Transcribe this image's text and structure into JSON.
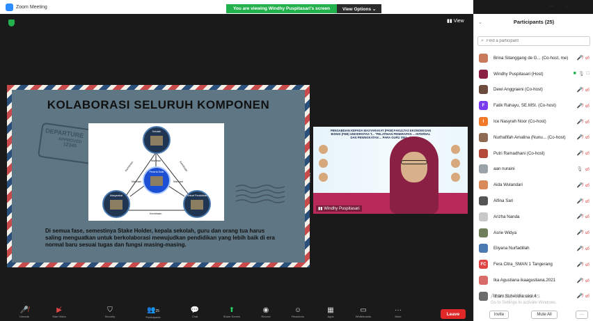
{
  "window": {
    "title": "Zoom Meeting",
    "share_banner": "You are viewing Windhy Puspitasari's screen",
    "view_options": "View Options ⌄",
    "minimize": "–",
    "maximize": "▫",
    "view_label": "View"
  },
  "slide": {
    "title": "KOLABORASI SELURUH KOMPONEN",
    "stamp_line1": "DEPARTURE",
    "stamp_line2": "APPROVED",
    "stamp_line3": "12345",
    "node_top": "Sekolah",
    "node_center": "Peserta Didik",
    "node_left": "Masyarakat",
    "node_right": "Sekuel Pendidikan",
    "edge_top_inner": "Manfaat",
    "edge_left_inner": "Manfaat",
    "edge_right_inner": "Manfaat",
    "edge_left_outer": "Kemitraan",
    "edge_right_outer": "Kemitraan",
    "edge_bottom": "Kemitraan",
    "body_text": "Di semua fase, semestinya Stake Holder, kepala sekolah, guru dan orang tua harus saling menguatkan untuk berkolaborasi mewujudkan pendidikan yang lebih baik di era normal baru sesuai tugas dan fungsi masing-masing."
  },
  "video": {
    "banner_text": "PENGABDIAN KEPADA MASYARAKAT (PKM) FAKULTAS EKONOMI DAN BISNIS (FEB) UNIVERSITAS T... \"PELATIHAN PENERAPAN ... INTERNAL DAN PENINGKATAN ... PARA GURU SMA...\"",
    "participant_name": "Windhy Puspitasari"
  },
  "toolbar": {
    "items": [
      {
        "icon": "mic-muted-icon",
        "glyph": "🎤̸",
        "label": "Unmute",
        "color": "red"
      },
      {
        "icon": "video-off-icon",
        "glyph": "▶̸",
        "label": "Start Video",
        "color": "red"
      },
      {
        "icon": "security-icon",
        "glyph": "⛉",
        "label": "Security",
        "color": ""
      },
      {
        "icon": "participants-icon",
        "glyph": "👥",
        "label": "Participants",
        "count": "25",
        "color": ""
      },
      {
        "icon": "chat-icon",
        "glyph": "💬",
        "label": "Chat",
        "color": ""
      },
      {
        "icon": "share-screen-icon",
        "glyph": "⬆",
        "label": "Share Screen",
        "color": "green"
      },
      {
        "icon": "record-icon",
        "glyph": "◉",
        "label": "Record",
        "color": ""
      },
      {
        "icon": "reactions-icon",
        "glyph": "☺",
        "label": "Reactions",
        "color": ""
      },
      {
        "icon": "apps-icon",
        "glyph": "▦",
        "label": "Apps",
        "color": ""
      },
      {
        "icon": "whiteboard-icon",
        "glyph": "▭",
        "label": "Whiteboards",
        "color": ""
      },
      {
        "icon": "more-icon",
        "glyph": "···",
        "label": "More",
        "color": ""
      }
    ],
    "leave_label": "Leave"
  },
  "panel": {
    "title": "Participants (25)",
    "search_placeholder": "Find a participant",
    "participants": [
      {
        "name": "Brina Sitanggang de G...  (Co-host, me)",
        "avatar": "photo",
        "avatar_color": "#c97a5b",
        "initials": "",
        "mic": "muted",
        "cam": "off"
      },
      {
        "name": "Windhy Puspitasari (Host)",
        "avatar": "photo",
        "avatar_color": "#8a2044",
        "initials": "",
        "mic": "on",
        "cam": "on"
      },
      {
        "name": "Dewi Anggraeni (Co-host)",
        "avatar": "photo",
        "avatar_color": "#6b4b3e",
        "initials": "",
        "mic": "muted",
        "cam": "off"
      },
      {
        "name": "Fatik Rahayu, SE.MSI. (Co-host)",
        "avatar": "initial",
        "avatar_color": "#7a3cf0",
        "initials": "F",
        "mic": "muted",
        "cam": "off"
      },
      {
        "name": "Ice Nasyrah Noor (Co-host)",
        "avatar": "initial",
        "avatar_color": "#f07a2a",
        "initials": "I",
        "mic": "muted",
        "cam": "off"
      },
      {
        "name": "Nurhafifah Amalina (Nunu...  (Co-host)",
        "avatar": "photo",
        "avatar_color": "#8e6a52",
        "initials": "",
        "mic": "muted",
        "cam": "off"
      },
      {
        "name": "Putri Ramadhani (Co-host)",
        "avatar": "photo",
        "avatar_color": "#b34a3a",
        "initials": "",
        "mic": "muted",
        "cam": "off"
      },
      {
        "name": "aan nuraini",
        "avatar": "photo",
        "avatar_color": "#9aa3a8",
        "initials": "",
        "mic": "on",
        "cam": "off"
      },
      {
        "name": "Aida Wulandari",
        "avatar": "photo",
        "avatar_color": "#d98a5a",
        "initials": "",
        "mic": "muted",
        "cam": "off"
      },
      {
        "name": "Alfina Sari",
        "avatar": "photo",
        "avatar_color": "#555555",
        "initials": "",
        "mic": "muted",
        "cam": "off"
      },
      {
        "name": "Arizha Nanda",
        "avatar": "photo",
        "avatar_color": "#c8c8c8",
        "initials": "",
        "mic": "muted",
        "cam": "off"
      },
      {
        "name": "Asrie Widya",
        "avatar": "photo",
        "avatar_color": "#6f7f5a",
        "initials": "",
        "mic": "muted",
        "cam": "off"
      },
      {
        "name": "Eliyana Nurfadillah",
        "avatar": "photo",
        "avatar_color": "#4a7ab0",
        "initials": "",
        "mic": "muted",
        "cam": "off"
      },
      {
        "name": "Fera Citra_SMAN 1 Tangerang",
        "avatar": "initial",
        "avatar_color": "#e04545",
        "initials": "FC",
        "mic": "muted",
        "cam": "off"
      },
      {
        "name": "Ika Agustiana ikaagustiana.2021",
        "avatar": "photo",
        "avatar_color": "#d96a6a",
        "initials": "",
        "mic": "muted",
        "cam": "off"
      },
      {
        "name": "Ilham Suhendra sesi 4",
        "avatar": "photo",
        "avatar_color": "#6b6b6b",
        "initials": "",
        "mic": "muted",
        "cam": "off"
      }
    ],
    "invite_label": "Invite",
    "mute_all_label": "Mute All",
    "more_label": "···"
  },
  "watermark": {
    "line1": "Activate Windows",
    "line2": "Go to Settings to activate Windows."
  },
  "colors": {
    "zoom_blue": "#2d8cff",
    "share_green": "#23b14d",
    "leave_red": "#e02828",
    "muted_red": "#dd3333"
  }
}
